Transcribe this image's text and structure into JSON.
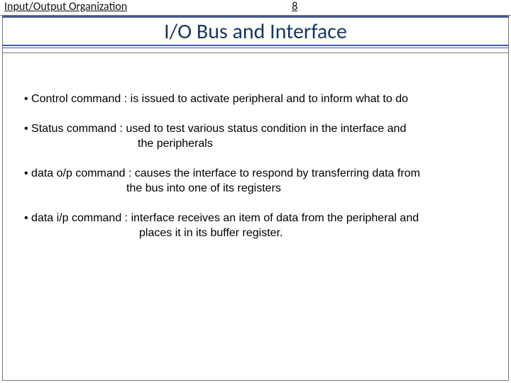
{
  "header": {
    "chapter": "Input/Output Organization",
    "page_number": "8"
  },
  "title": "I/O Bus and Interface",
  "bullets": {
    "b1": "• Control  command : is issued to activate peripheral and to inform what to do",
    "b2_line1": "• Status command : used to test various status condition in the interface and",
    "b2_line2": "the peripherals",
    "b3_line1": "• data o/p command :  causes the interface to respond by transferring data from",
    "b3_line2": "the bus into one of its registers",
    "b4_line1": "• data i/p command : interface receives an item of data from the peripheral and",
    "b4_line2": "places it in its buffer register."
  }
}
